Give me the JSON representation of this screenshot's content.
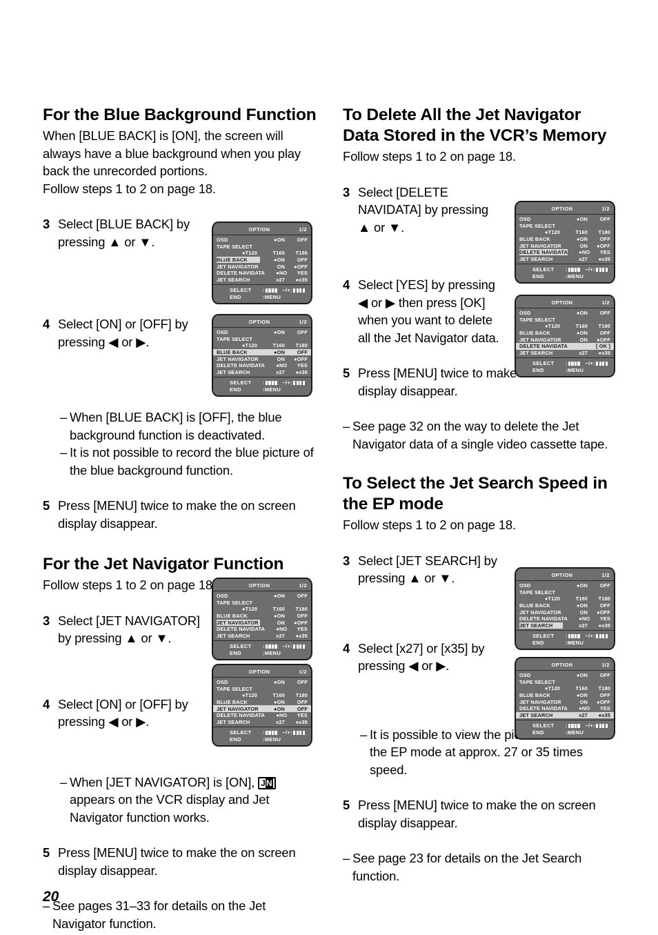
{
  "page": {
    "number": "20"
  },
  "osd_menu": {
    "title": "OPTION",
    "page_indicator": "1/2",
    "footer": {
      "select_label": "SELECT",
      "select_value": ":",
      "updown_label": "−/+:",
      "end_label": "END",
      "end_value": ":MENU"
    },
    "rows": [
      {
        "label": "OSD",
        "v1": "●ON",
        "v2": "OFF"
      },
      {
        "label": "TAPE SELECT",
        "v1": "",
        "v2": ""
      },
      {
        "label": "",
        "v0": "●T120",
        "v1": "T160",
        "v2": "T180"
      },
      {
        "label": "BLUE BACK",
        "v1": "●ON",
        "v2": "OFF"
      },
      {
        "label": "JET NAVIGATOR",
        "v1": "ON",
        "v2": "●OFF"
      },
      {
        "label": "DELETE NAVIDATA",
        "v1": "●NO",
        "v2": "YES"
      },
      {
        "label": "JET SEARCH",
        "v1": "x27",
        "v2": "●x35"
      }
    ],
    "variants": {
      "blue_back_selected": {
        "highlight_row": 3,
        "highlight_mode": "label"
      },
      "blue_back_value": {
        "highlight_row": 3,
        "highlight_mode": "full"
      },
      "jet_navigator_selected": {
        "highlight_row": 4,
        "highlight_mode": "label"
      },
      "jet_navigator_on": {
        "highlight_row": 4,
        "highlight_mode": "full",
        "row4_v1": "●ON",
        "row4_v2": "OFF"
      },
      "delete_navidata_selected": {
        "highlight_row": 5,
        "highlight_mode": "label"
      },
      "delete_navidata_ok": {
        "highlight_row": 5,
        "highlight_mode": "full",
        "row5_v1": "",
        "row5_v2": "[ OK ]"
      },
      "jet_search_selected": {
        "highlight_row": 6,
        "highlight_mode": "label"
      },
      "jet_search_x35": {
        "highlight_row": 6,
        "highlight_mode": "full"
      }
    }
  },
  "left_column": {
    "section1": {
      "heading": "For the Blue Background Function",
      "intro": "When [BLUE BACK] is [ON], the screen will always have a blue background when you play back the unrecorded portions.",
      "follow": "Follow steps 1 to 2 on page 18.",
      "step3": {
        "num": "3",
        "text": "Select [BLUE BACK] by pressing ▲ or ▼."
      },
      "step4": {
        "num": "4",
        "text": "Select [ON] or [OFF] by pressing ◀ or ▶."
      },
      "note1": "When [BLUE BACK] is [OFF], the blue background function is deactivated.",
      "note2": "It is not possible to record the blue picture of the blue background function.",
      "step5": {
        "num": "5",
        "text": "Press [MENU] twice to make the on screen display disappear."
      }
    },
    "section2": {
      "heading": "For the Jet Navigator Function",
      "follow": "Follow steps 1 to 2 on page 18.",
      "step3": {
        "num": "3",
        "text": "Select [JET NAVIGATOR] by pressing ▲ or ▼."
      },
      "step4": {
        "num": "4",
        "text": "Select [ON] or [OFF] by pressing ◀ or ▶."
      },
      "note1_pre": "When [JET NAVIGATOR] is [ON],",
      "note1_icon": "jet-navigator-badge",
      "note1_post": "appears on the VCR display and Jet Navigator function works.",
      "step5": {
        "num": "5",
        "text": "Press [MENU] twice to make the on screen display disappear."
      },
      "note2": "See pages 31–33 for details on the Jet Navigator function."
    }
  },
  "right_column": {
    "section1": {
      "heading": "To Delete All the Jet Navigator Data Stored in the VCR’s Memory",
      "follow": "Follow steps 1 to 2 on page 18.",
      "step3": {
        "num": "3",
        "text": "Select [DELETE NAVIDATA] by pressing ▲ or ▼."
      },
      "step4": {
        "num": "4",
        "text": "Select [YES] by pressing ◀ or ▶ then press [OK] when you want to delete all the Jet Navigator data."
      },
      "step5": {
        "num": "5",
        "text": "Press [MENU] twice to make the on screen display disappear."
      },
      "note1": "See page 32 on the way to delete the Jet Navigator data of a single video cassette tape."
    },
    "section2": {
      "heading": "To Select the Jet Search Speed in the EP mode",
      "follow": "Follow steps 1 to 2 on page 18.",
      "step3": {
        "num": "3",
        "text": "Select [JET SEARCH] by pressing ▲ or ▼."
      },
      "step4": {
        "num": "4",
        "text": "Select [x27] or [x35] by pressing ◀ or ▶."
      },
      "note1": "It is possible to view the picture recorded in the EP mode at approx. 27 or 35 times speed.",
      "step5": {
        "num": "5",
        "text": "Press [MENU] twice to make the on screen display disappear."
      },
      "note2": "See page 23 for details on the Jet Search function."
    }
  }
}
